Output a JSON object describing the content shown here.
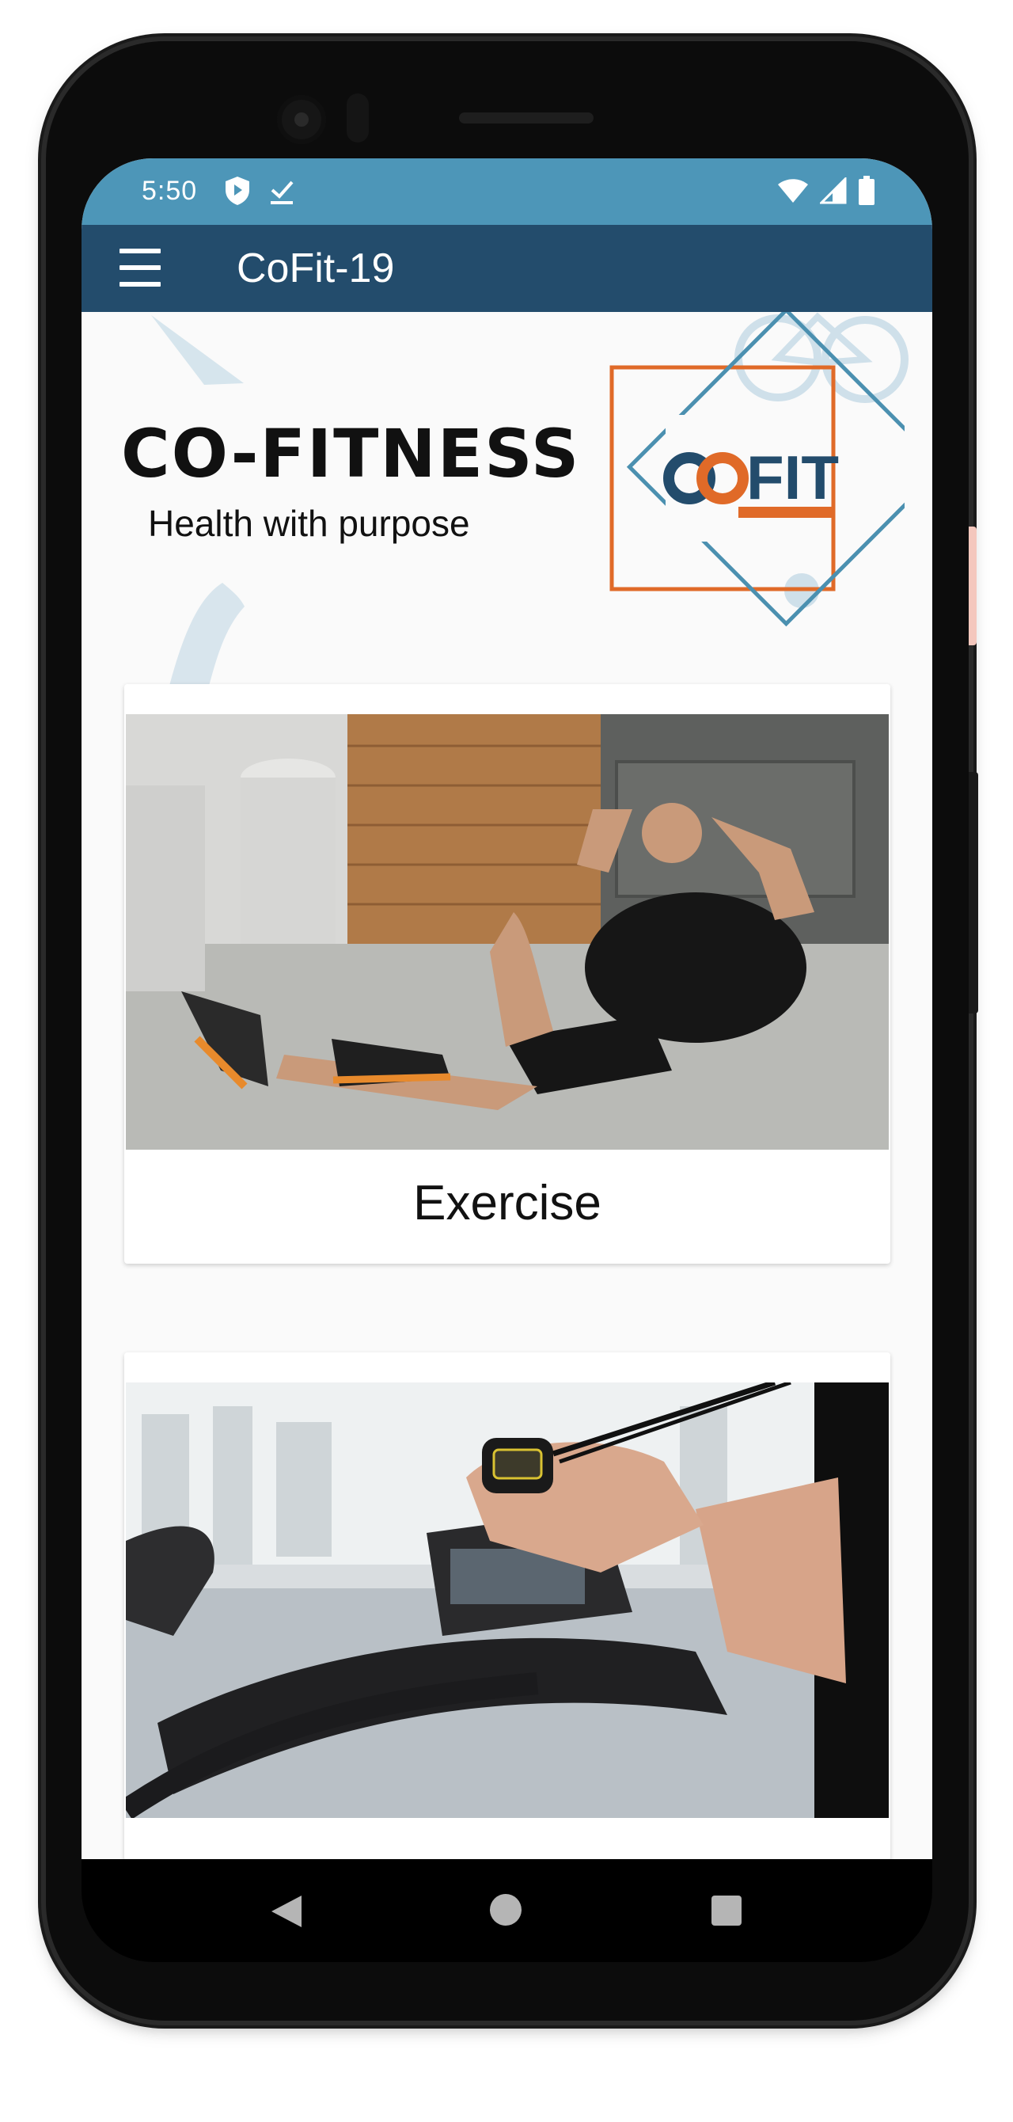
{
  "status_bar": {
    "time": "5:50",
    "icons_left": [
      "shield-icon",
      "download-done-icon"
    ],
    "icons_right": [
      "wifi-icon",
      "signal-icon",
      "battery-icon"
    ]
  },
  "app_bar": {
    "title": "CoFit-19",
    "menu_icon": "hamburger-menu-icon",
    "color": "#234c6c"
  },
  "status_bar_color": "#4d96b8",
  "header": {
    "title": "CO-FITNESS",
    "subtitle": "Health with purpose",
    "logo_text": "FIT",
    "logo_colors": {
      "navy": "#234c6c",
      "orange": "#e06a28",
      "teal": "#4b90b0"
    }
  },
  "cards": [
    {
      "label": "Exercise",
      "image": "man-doing-crunches-photo"
    },
    {
      "label": "",
      "image": "stopwatch-treadmill-photo"
    }
  ],
  "nav_bar": {
    "icons": [
      "back-icon",
      "home-icon",
      "recents-icon"
    ]
  }
}
